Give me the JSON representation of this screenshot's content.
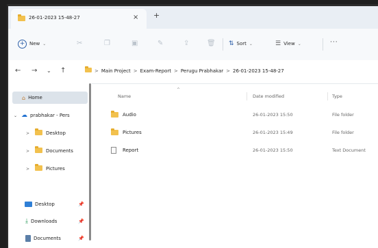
{
  "window": {
    "tab_title": "26-01-2023 15-48-27",
    "tab_close": "×",
    "new_tab": "+"
  },
  "toolbar": {
    "new_label": "New",
    "sort_label": "Sort",
    "view_label": "View",
    "more_label": "···",
    "chevron": "⌄"
  },
  "nav": {
    "back": "←",
    "forward": "→",
    "recent": "⌄",
    "up": "↑"
  },
  "breadcrumb": {
    "items": [
      "Main Project",
      "Exam-Report",
      "Perugu Prabhakar",
      "26-01-2023 15-48-27"
    ],
    "separator": ">"
  },
  "sidebar": {
    "home": "Home",
    "onedrive": "prabhakar - Pers",
    "items": [
      "Desktop",
      "Documents",
      "Pictures"
    ],
    "quick": [
      "Desktop",
      "Downloads",
      "Documents"
    ],
    "pin": "📌"
  },
  "columns": {
    "name": "Name",
    "date": "Date modified",
    "type": "Type"
  },
  "files": [
    {
      "name": "Audio",
      "date": "26-01-2023 15:50",
      "type": "File folder",
      "icon": "folder-icon"
    },
    {
      "name": "Pictures",
      "date": "26-01-2023 15:49",
      "type": "File folder",
      "icon": "folder-icon"
    },
    {
      "name": "Report",
      "date": "26-01-2023 15:50",
      "type": "Text Document",
      "icon": "text-document-icon"
    }
  ],
  "colors": {
    "folder": "#f2c14e",
    "accent": "#2d5fa8",
    "selection": "#dce3ea"
  }
}
